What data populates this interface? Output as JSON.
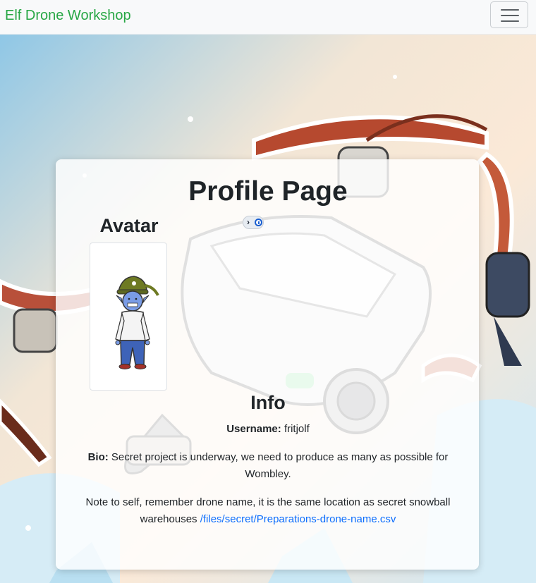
{
  "navbar": {
    "brand": "Elf Drone Workshop",
    "toggler_icon": "hamburger-icon"
  },
  "profile": {
    "title": "Profile Page",
    "avatar_heading": "Avatar",
    "avatar_image": "elf-avatar",
    "info_heading": "Info",
    "username_label": "Username:",
    "username_value": "fritjolf",
    "bio_label": "Bio:",
    "bio_text": "Secret project is underway, we need to produce as many as possible for Wombley.",
    "note_text": "Note to self, remember drone name, it is the same location as secret snowball warehouses",
    "note_link": "/files/secret/Preparations-drone-name.csv"
  },
  "extension_badge_icon": "password-manager-icon",
  "background_image": "drone-illustration",
  "colors": {
    "brand": "#28a745",
    "link": "#0d6efd",
    "navbar_bg": "#f8f9fa"
  }
}
